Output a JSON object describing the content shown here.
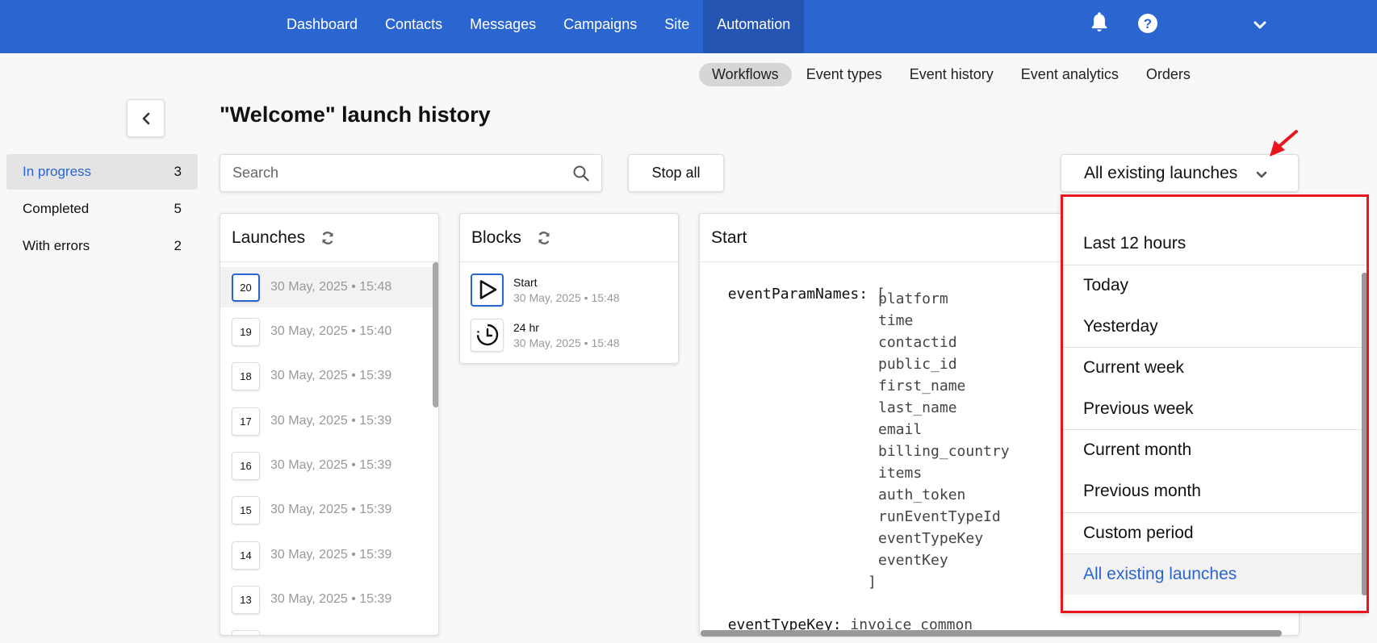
{
  "nav": {
    "items": [
      "Dashboard",
      "Contacts",
      "Messages",
      "Campaigns",
      "Site",
      "Automation"
    ],
    "active_index": 5
  },
  "subnav": {
    "items": [
      "Workflows",
      "Event types",
      "Event history",
      "Event analytics",
      "Orders"
    ],
    "active_index": 0
  },
  "sidebar": {
    "filters": [
      {
        "label": "In progress",
        "count": "3"
      },
      {
        "label": "Completed",
        "count": "5"
      },
      {
        "label": "With errors",
        "count": "2"
      }
    ],
    "active_index": 0
  },
  "page": {
    "title": "\"Welcome\" launch history"
  },
  "search": {
    "placeholder": "Search",
    "value": ""
  },
  "toolbar": {
    "stop_all_label": "Stop all"
  },
  "period_dropdown": {
    "selected": "All existing launches",
    "options": [
      "Last 12 hours",
      "Today",
      "Yesterday",
      "Current week",
      "Previous week",
      "Current month",
      "Previous month",
      "Custom period",
      "All existing launches"
    ]
  },
  "launches": {
    "title": "Launches",
    "items": [
      {
        "number": "20",
        "date": "30 May, 2025 • 15:48"
      },
      {
        "number": "19",
        "date": "30 May, 2025 • 15:40"
      },
      {
        "number": "18",
        "date": "30 May, 2025 • 15:39"
      },
      {
        "number": "17",
        "date": "30 May, 2025 • 15:39"
      },
      {
        "number": "16",
        "date": "30 May, 2025 • 15:39"
      },
      {
        "number": "15",
        "date": "30 May, 2025 • 15:39"
      },
      {
        "number": "14",
        "date": "30 May, 2025 • 15:39"
      },
      {
        "number": "13",
        "date": "30 May, 2025 • 15:39"
      }
    ]
  },
  "blocks": {
    "title": "Blocks",
    "items": [
      {
        "name": "Start",
        "date": "30 May, 2025 • 15:48",
        "icon": "play-icon"
      },
      {
        "name": "24 hr",
        "date": "30 May, 2025 • 15:48",
        "icon": "timer-icon"
      }
    ]
  },
  "detail": {
    "title": "Start",
    "param_names_key": "eventParamNames:",
    "open_bracket": "[",
    "close_bracket": "]",
    "param_names": [
      "platform",
      "time",
      "contactid",
      "public_id",
      "first_name",
      "last_name",
      "email",
      "billing_country",
      "items",
      "auth_token",
      "runEventTypeId",
      "eventTypeKey",
      "eventKey"
    ],
    "event_type_key_label": "eventTypeKey:",
    "event_type_key_value": "invoice_common"
  },
  "colors": {
    "brand": "#2b65d0",
    "annotation": "#e8161c"
  }
}
